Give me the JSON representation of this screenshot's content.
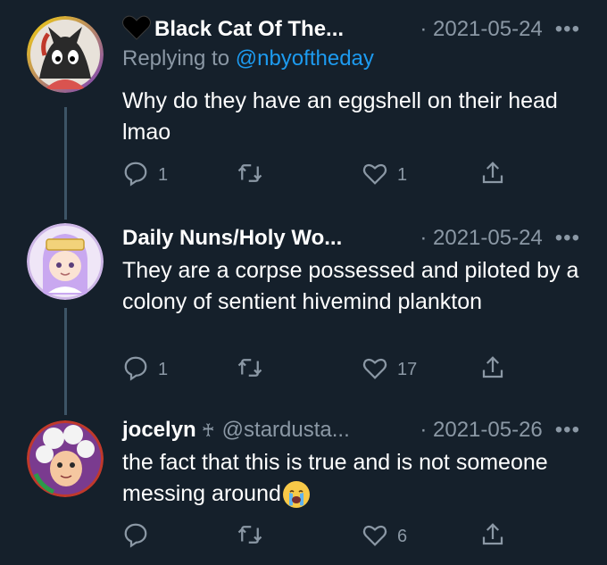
{
  "tweets": [
    {
      "name": "Black Cat Of The...",
      "handle": "",
      "date": "· 2021-05-24",
      "reply_prefix": "Replying to ",
      "reply_mention": "@nbyoftheday",
      "text": "Why do they have an eggshell on their head lmao",
      "replies": "1",
      "retweets": "",
      "likes": "1"
    },
    {
      "name": "Daily Nuns/Holy Wo...",
      "handle": "",
      "date": "· 2021-05-24",
      "text": "They are a corpse possessed and piloted by a colony of sentient hivemind plankton",
      "replies": "1",
      "retweets": "",
      "likes": "17"
    },
    {
      "name": "jocelyn",
      "name_symbol": "♰",
      "handle": "@stardusta...",
      "date": "· 2021-05-26",
      "text": "the fact that this is true and is not someone messing around",
      "replies": "",
      "retweets": "",
      "likes": "6"
    }
  ],
  "more_label": "•••",
  "icons": {
    "reply": "reply-icon",
    "retweet": "retweet-icon",
    "like": "heart-icon",
    "share": "share-icon",
    "name_heart": "black-heart-icon",
    "crying": "crying-face-emoji"
  },
  "colors": {
    "background": "#15202b",
    "text": "#ffffff",
    "secondary": "#8b98a5",
    "link": "#1d9bf0",
    "thread_line": "#3d5466"
  }
}
